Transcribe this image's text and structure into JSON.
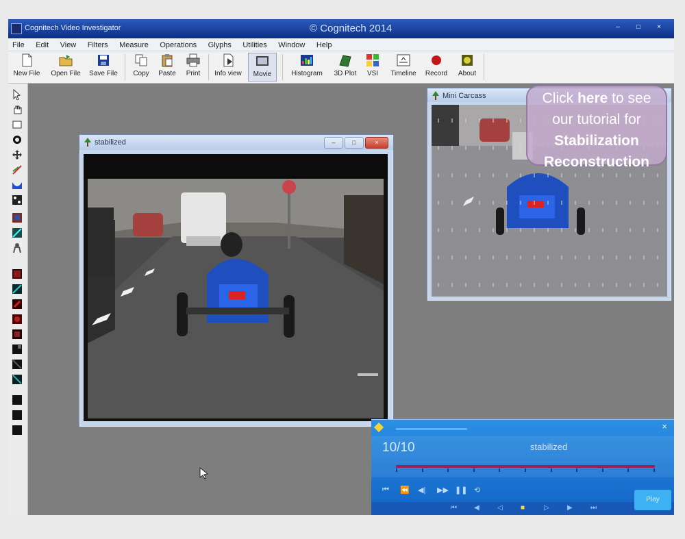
{
  "app": {
    "title": "Cognitech Video Investigator",
    "center_caption": "© Cognitech 2014",
    "window_buttons": [
      "–",
      "□",
      "×"
    ]
  },
  "menu": [
    "File",
    "Edit",
    "View",
    "Filters",
    "Measure",
    "Operations",
    "Glyphs",
    "Utilities",
    "Window",
    "Help"
  ],
  "toolbar": [
    {
      "label": "New File",
      "icon": "new-file-icon"
    },
    {
      "label": "Open File",
      "icon": "open-file-icon"
    },
    {
      "label": "Save File",
      "icon": "save-file-icon"
    },
    {
      "label": "Copy",
      "icon": "copy-icon"
    },
    {
      "label": "Paste",
      "icon": "paste-icon"
    },
    {
      "label": "Print",
      "icon": "print-icon"
    },
    {
      "label": "Info view",
      "icon": "info-view-icon"
    },
    {
      "label": "Movie",
      "icon": "movie-icon"
    },
    {
      "label": "Histogram",
      "icon": "histogram-icon"
    },
    {
      "label": "3D Plot",
      "icon": "3d-plot-icon"
    },
    {
      "label": "VSI",
      "icon": "vsi-icon"
    },
    {
      "label": "Timeline",
      "icon": "timeline-icon"
    },
    {
      "label": "Record",
      "icon": "record-icon"
    },
    {
      "label": "About",
      "icon": "about-icon"
    }
  ],
  "stabilized_window": {
    "title": "stabilized",
    "buttons": [
      "–",
      "□",
      "×"
    ]
  },
  "mini_window": {
    "title": "Mini Carcass"
  },
  "tutorial": {
    "line1_pre": "Click ",
    "line1_bold": "here",
    "line1_post": " to see",
    "line2": "our tutorial for",
    "line3": "Stabilization",
    "line4": "Reconstruction"
  },
  "player": {
    "frame_counter": "10/10",
    "stream_name": "stabilized",
    "close": "×",
    "position_fraction": 1.0,
    "side_button": "Play"
  },
  "colors": {
    "titlebar": "#0d2f86",
    "workspace": "#7e7e7e",
    "player": "#1a73d6",
    "track": "#9c1f55"
  }
}
